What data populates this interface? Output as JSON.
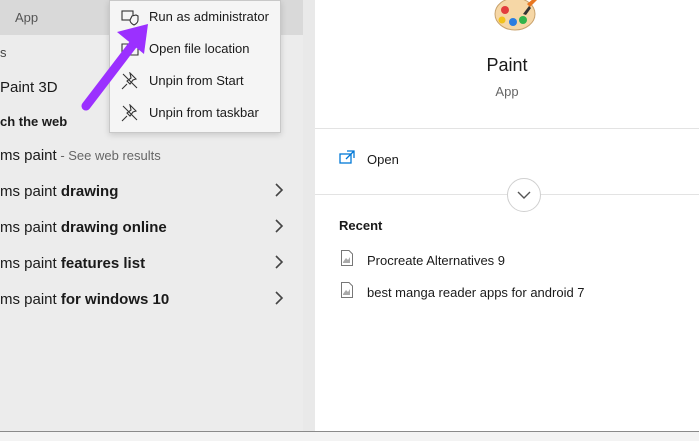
{
  "left_panel": {
    "app_label": "App",
    "s_char": "s",
    "paint3d": {
      "prefix": "Paint",
      "suffix": " 3D"
    },
    "search_web": "ch the web",
    "results": [
      {
        "prefix": "ms paint",
        "bold": "",
        "extra": " - See web results"
      },
      {
        "prefix": "ms paint ",
        "bold": "drawing",
        "extra": ""
      },
      {
        "prefix": "ms paint ",
        "bold": "drawing online",
        "extra": ""
      },
      {
        "prefix": "ms paint ",
        "bold": "features list",
        "extra": ""
      },
      {
        "prefix": "ms paint ",
        "bold": "for windows 10",
        "extra": ""
      }
    ]
  },
  "context_menu": {
    "items": [
      {
        "label": "Run as administrator",
        "icon": "shield-icon"
      },
      {
        "label": "Open file location",
        "icon": "folder-icon"
      },
      {
        "label": "Unpin from Start",
        "icon": "unpin-icon"
      },
      {
        "label": "Unpin from taskbar",
        "icon": "unpin-icon"
      }
    ]
  },
  "annotation": {
    "color": "#9b30ff"
  },
  "right_panel": {
    "app_name": "Paint",
    "app_type": "App",
    "open_label": "Open",
    "recent_header": "Recent",
    "recent_items": [
      "Procreate Alternatives 9",
      "best manga reader apps for android 7"
    ]
  },
  "colors": {
    "accent": "#0078d7",
    "arrow": "#9b30ff"
  }
}
